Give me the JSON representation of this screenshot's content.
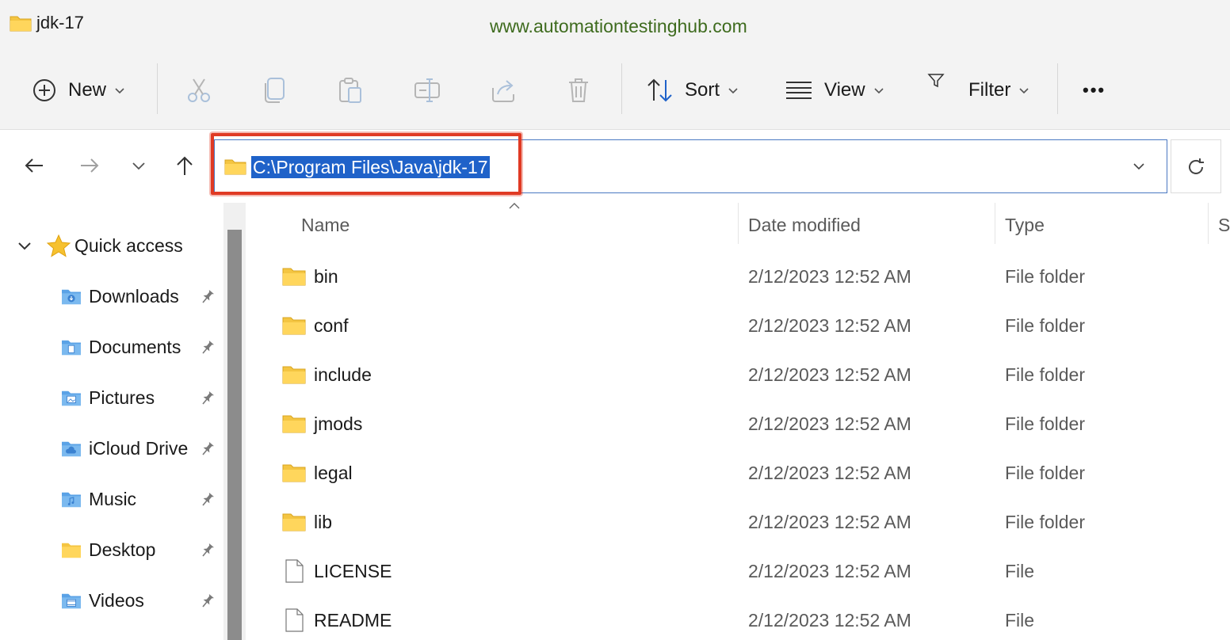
{
  "window": {
    "title": "jdk-17",
    "watermark": "www.automationtestinghub.com"
  },
  "toolbar": {
    "new_label": "New",
    "sort_label": "Sort",
    "view_label": "View",
    "filter_label": "Filter",
    "more_label": "•••",
    "icons": [
      "cut-icon",
      "copy-icon",
      "paste-icon",
      "rename-icon",
      "share-icon",
      "delete-icon"
    ]
  },
  "address": {
    "path": "C:\\Program Files\\Java\\jdk-17"
  },
  "columns": {
    "name": "Name",
    "date": "Date modified",
    "type": "Type",
    "size": "S"
  },
  "sidebar": {
    "quick_access": "Quick access",
    "items": [
      {
        "label": "Downloads",
        "icon": "downloads-folder-icon"
      },
      {
        "label": "Documents",
        "icon": "documents-folder-icon"
      },
      {
        "label": "Pictures",
        "icon": "pictures-folder-icon"
      },
      {
        "label": "iCloud Drive",
        "icon": "icloud-folder-icon"
      },
      {
        "label": "Music",
        "icon": "music-folder-icon"
      },
      {
        "label": "Desktop",
        "icon": "desktop-folder-icon"
      },
      {
        "label": "Videos",
        "icon": "videos-folder-icon"
      }
    ]
  },
  "files": [
    {
      "name": "bin",
      "date": "2/12/2023 12:52 AM",
      "type": "File folder",
      "kind": "folder"
    },
    {
      "name": "conf",
      "date": "2/12/2023 12:52 AM",
      "type": "File folder",
      "kind": "folder"
    },
    {
      "name": "include",
      "date": "2/12/2023 12:52 AM",
      "type": "File folder",
      "kind": "folder"
    },
    {
      "name": "jmods",
      "date": "2/12/2023 12:52 AM",
      "type": "File folder",
      "kind": "folder"
    },
    {
      "name": "legal",
      "date": "2/12/2023 12:52 AM",
      "type": "File folder",
      "kind": "folder"
    },
    {
      "name": "lib",
      "date": "2/12/2023 12:52 AM",
      "type": "File folder",
      "kind": "folder"
    },
    {
      "name": "LICENSE",
      "date": "2/12/2023 12:52 AM",
      "type": "File",
      "kind": "file"
    },
    {
      "name": "README",
      "date": "2/12/2023 12:52 AM",
      "type": "File",
      "kind": "file"
    }
  ],
  "colors": {
    "accent": "#1f62c9",
    "highlight": "#e03a24",
    "folder": "#f4c542"
  }
}
